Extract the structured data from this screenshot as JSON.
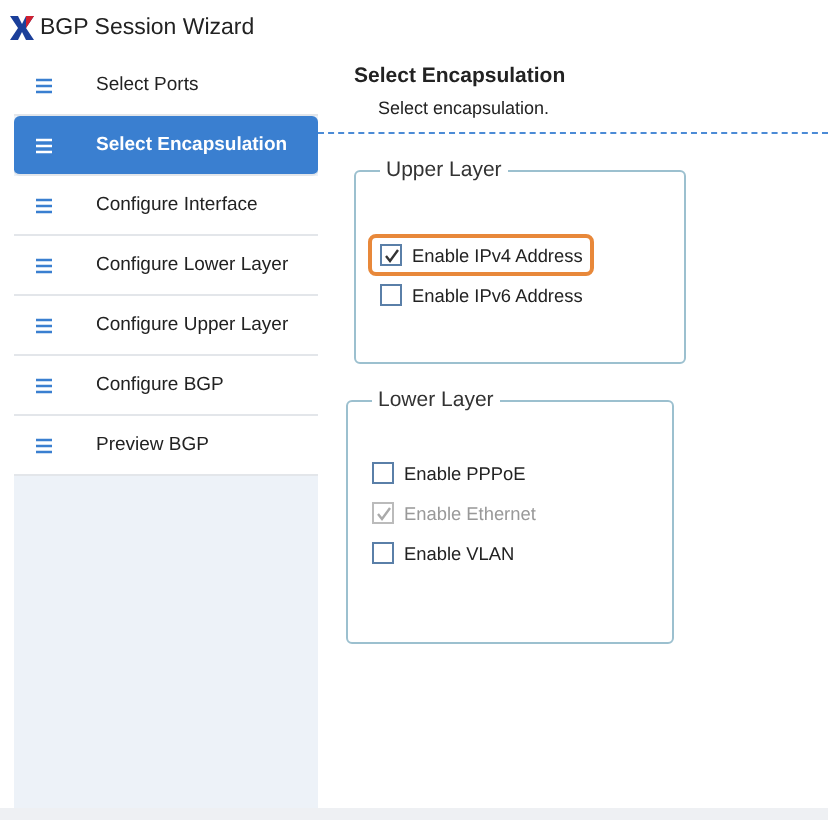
{
  "window": {
    "title": "BGP Session Wizard"
  },
  "sidebar": {
    "items": [
      {
        "label": "Select Ports",
        "selected": false
      },
      {
        "label": "Select Encapsulation",
        "selected": true
      },
      {
        "label": "Configure Interface",
        "selected": false
      },
      {
        "label": "Configure Lower Layer",
        "selected": false
      },
      {
        "label": "Configure Upper Layer",
        "selected": false
      },
      {
        "label": "Configure BGP",
        "selected": false
      },
      {
        "label": "Preview BGP",
        "selected": false
      }
    ]
  },
  "page": {
    "title": "Select Encapsulation",
    "subtitle": "Select encapsulation."
  },
  "groups": [
    {
      "title": "Upper Layer",
      "options": [
        {
          "label": "Enable IPv4 Address",
          "checked": true,
          "disabled": false,
          "focused": true
        },
        {
          "label": "Enable IPv6 Address",
          "checked": false,
          "disabled": false,
          "focused": false
        }
      ]
    },
    {
      "title": "Lower Layer",
      "options": [
        {
          "label": "Enable PPPoE",
          "checked": false,
          "disabled": false,
          "focused": false
        },
        {
          "label": "Enable Ethernet",
          "checked": true,
          "disabled": true,
          "focused": false
        },
        {
          "label": "Enable VLAN",
          "checked": false,
          "disabled": false,
          "focused": false
        }
      ]
    }
  ]
}
